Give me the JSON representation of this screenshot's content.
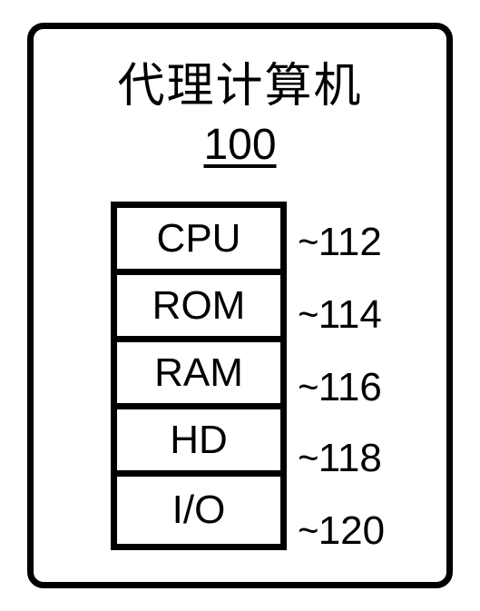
{
  "title": "代理计算机",
  "box_number": "100",
  "rows": [
    {
      "label": "CPU",
      "ref": "112"
    },
    {
      "label": "ROM",
      "ref": "114"
    },
    {
      "label": "RAM",
      "ref": "116"
    },
    {
      "label": "HD",
      "ref": "118"
    },
    {
      "label": "I/O",
      "ref": "120"
    }
  ],
  "ref_tops": [
    210,
    290,
    370,
    448,
    528
  ]
}
